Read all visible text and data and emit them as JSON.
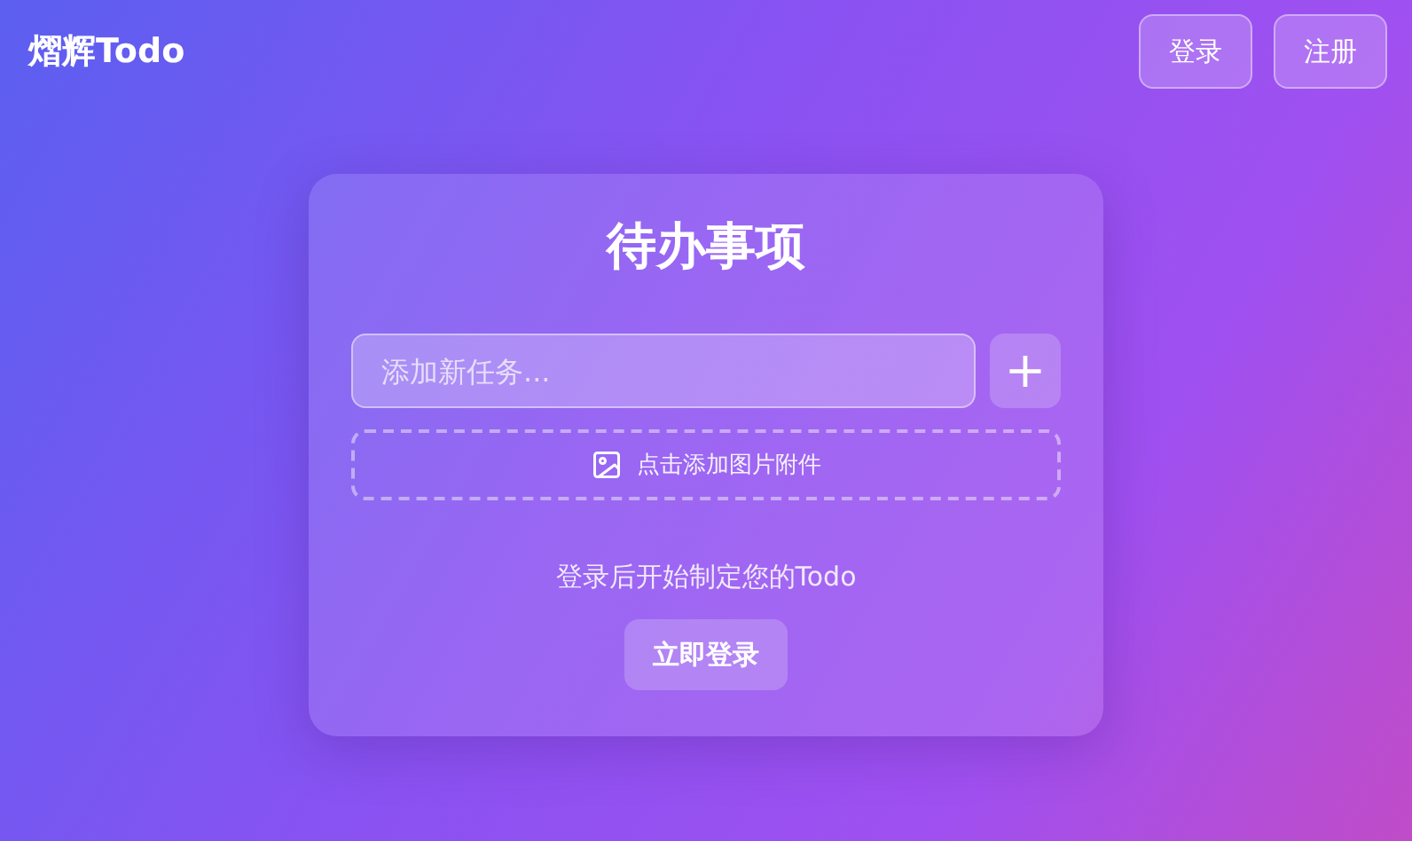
{
  "brand": "熠辉Todo",
  "nav_buttons": [
    "登录",
    "注册"
  ],
  "card": {
    "title": "待办事项",
    "task_input": {
      "placeholder": "添加新任务..."
    },
    "add_button": "+",
    "attach_label": "点击添加图片附件",
    "prompt": "登录后开始制定您的Todo",
    "login_button": "立即登录"
  }
}
